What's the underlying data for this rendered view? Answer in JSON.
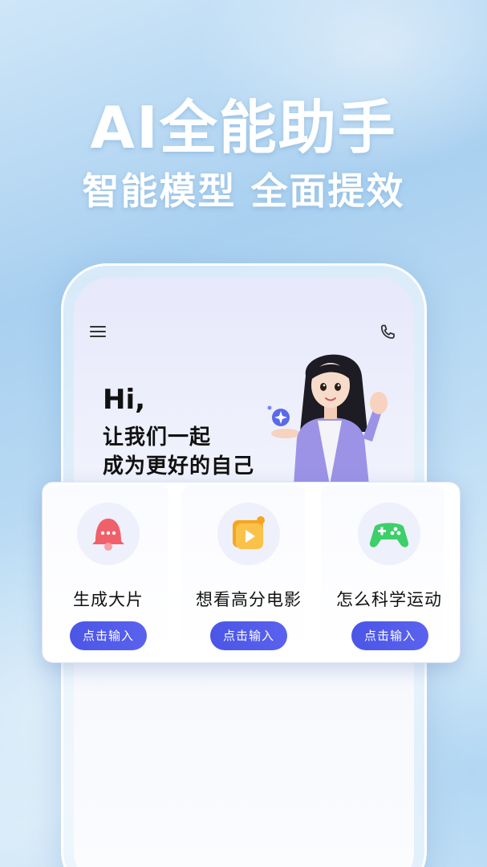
{
  "banner": {
    "headline": "AI全能助手",
    "subline": "智能模型 全面提效"
  },
  "app": {
    "greeting_hi": "Hi,",
    "greeting_line1": "让我们一起",
    "greeting_line2": "成为更好的自己"
  },
  "cards": [
    {
      "title": "生成大片",
      "button": "点击输入",
      "icon": "bell-chat-icon"
    },
    {
      "title": "想看高分电影",
      "button": "点击输入",
      "icon": "movie-play-icon"
    },
    {
      "title": "怎么科学运动",
      "button": "点击输入",
      "icon": "game-controller-icon"
    }
  ],
  "colors": {
    "accent": "#4b56e6",
    "bell": "#f0606a",
    "movie": "#f7a520",
    "game": "#3ccf6a"
  }
}
